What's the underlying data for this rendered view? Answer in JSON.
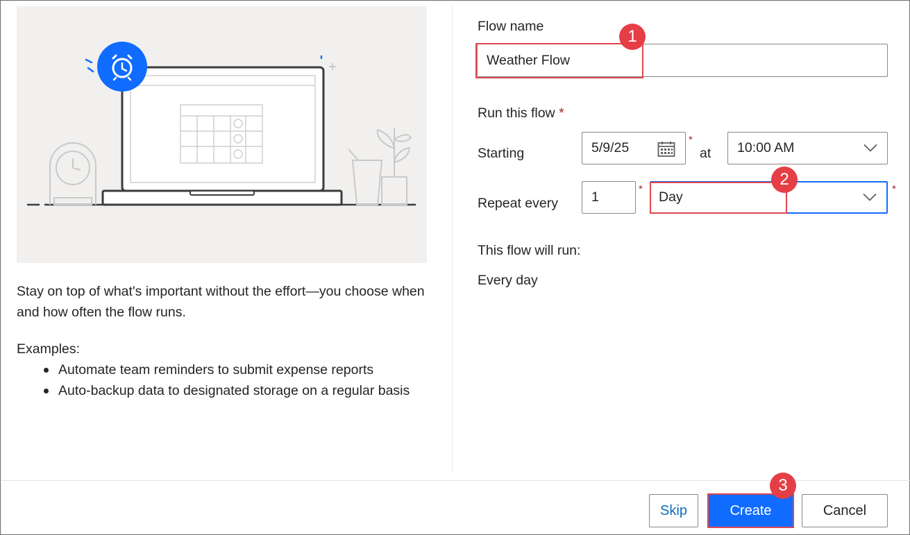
{
  "form": {
    "flow_name_label": "Flow name",
    "flow_name_value": "Weather Flow",
    "run_label": "Run this flow",
    "required_mark": "*",
    "starting_label": "Starting",
    "start_date": "5/9/25",
    "at_label": "at",
    "start_time": "10:00 AM",
    "repeat_label": "Repeat every",
    "repeat_count": "1",
    "repeat_unit": "Day",
    "summary_label": "This flow will run:",
    "summary_value": "Every day"
  },
  "info": {
    "description": "Stay on top of what's important without the effort—you choose when and how often the flow runs.",
    "examples_title": "Examples:",
    "examples": [
      "Automate team reminders to submit expense reports",
      "Auto-backup data to designated storage on a regular basis"
    ]
  },
  "footer": {
    "skip_label": "Skip",
    "create_label": "Create",
    "cancel_label": "Cancel"
  },
  "annotations": {
    "badge_1": "1",
    "badge_2": "2",
    "badge_3": "3"
  },
  "icons": {
    "alarm": "alarm-clock-icon",
    "calendar": "calendar-icon",
    "chevron": "chevron-down-icon"
  },
  "colors": {
    "accent": "#0f6cff",
    "annotation_red": "#e63e46",
    "required_red": "#a4262c",
    "illustration_bg": "#f1f0ef"
  }
}
